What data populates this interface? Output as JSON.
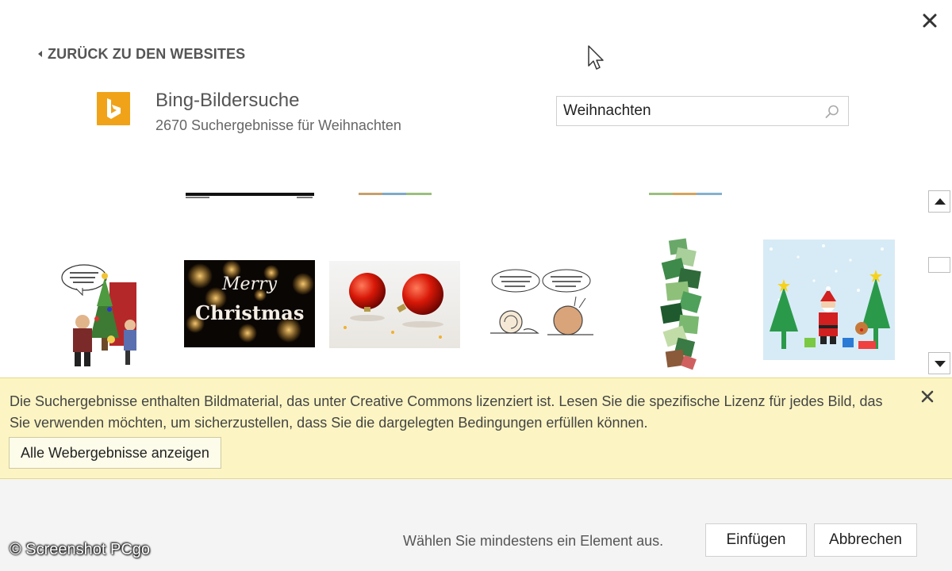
{
  "dialog": {
    "close_icon": "close-icon"
  },
  "nav": {
    "back_label": "ZURÜCK ZU DEN WEBSITES"
  },
  "provider": {
    "name": "Bing-Bildersuche",
    "result_count": "2670 Suchergebnisse für Weihnachten",
    "logo_color": "#f0a318"
  },
  "search": {
    "value": "Weihnachten",
    "icon": "search-icon"
  },
  "results": {
    "merry_line1": "Merry",
    "merry_line2": "Christmas"
  },
  "notice": {
    "text": "Die Suchergebnisse enthalten Bildmaterial, das unter Creative Commons lizenziert ist. Lesen Sie die spezifische Lizenz für jedes Bild, das Sie verwenden möchten, um sicherzustellen, dass Sie die dargelegten Bedingungen erfüllen können.",
    "button_label": "Alle Webergebnisse anzeigen",
    "background_color": "#fcf5c3"
  },
  "footer": {
    "hint": "Wählen Sie mindestens ein Element aus.",
    "insert_label": "Einfügen",
    "cancel_label": "Abbrechen"
  },
  "watermark": "© Screenshot PCgo"
}
